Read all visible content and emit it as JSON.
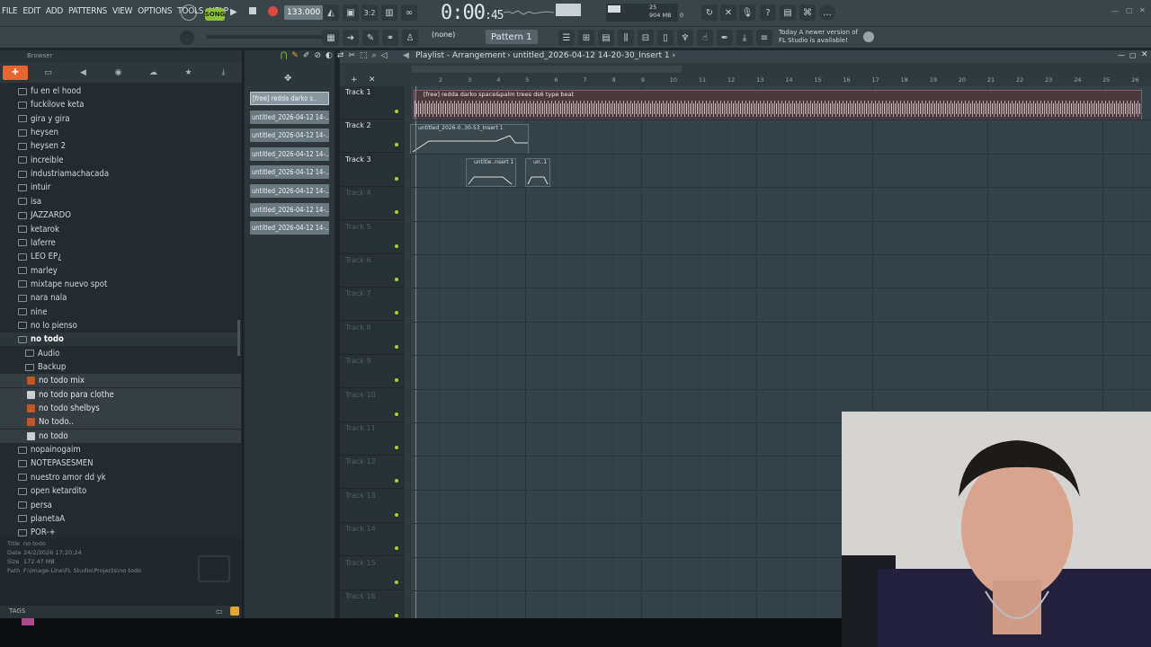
{
  "menu": [
    "FILE",
    "EDIT",
    "ADD",
    "PATTERNS",
    "VIEW",
    "OPTIONS",
    "TOOLS",
    "HELP"
  ],
  "transport": {
    "mode": "SONG",
    "tempo": "133.000",
    "time": "0:00",
    "time_sub": "45",
    "cpu": "25",
    "mem": "904 MB",
    "poly": "0"
  },
  "toolbar2": {
    "snap": "(none)",
    "pattern": "Pattern 1",
    "notice_line1": "Today  A newer version of",
    "notice_line2": "FL Studio is available!"
  },
  "browser": {
    "title": "Browser",
    "items": [
      {
        "label": "fu en el hood",
        "type": "folder"
      },
      {
        "label": "fuckilove keta",
        "type": "folder"
      },
      {
        "label": "gira y gira",
        "type": "folder"
      },
      {
        "label": "heysen",
        "type": "folder"
      },
      {
        "label": "heysen 2",
        "type": "folder"
      },
      {
        "label": "increible",
        "type": "folder"
      },
      {
        "label": "industriamachacada",
        "type": "folder"
      },
      {
        "label": "intuir",
        "type": "folder"
      },
      {
        "label": "isa",
        "type": "folder"
      },
      {
        "label": "JAZZARDO",
        "type": "folder"
      },
      {
        "label": "ketarok",
        "type": "folder"
      },
      {
        "label": "laferre",
        "type": "folder"
      },
      {
        "label": "LEO EP¿",
        "type": "folder"
      },
      {
        "label": "marley",
        "type": "folder"
      },
      {
        "label": "mixtape nuevo spot",
        "type": "folder"
      },
      {
        "label": "nara nala",
        "type": "folder"
      },
      {
        "label": "nine",
        "type": "folder"
      },
      {
        "label": "no lo pienso",
        "type": "folder"
      },
      {
        "label": "no todo",
        "type": "open"
      },
      {
        "label": "Audio",
        "type": "sub"
      },
      {
        "label": "Backup",
        "type": "sub"
      },
      {
        "label": "no todo mix",
        "type": "file"
      },
      {
        "label": "no todo para clothe",
        "type": "plainfile"
      },
      {
        "label": "no todo shelbys",
        "type": "file"
      },
      {
        "label": "No todo..",
        "type": "file"
      },
      {
        "label": "no todo",
        "type": "plainfile"
      },
      {
        "label": "nopainogaim",
        "type": "folder"
      },
      {
        "label": "NOTEPASESMEN",
        "type": "folder"
      },
      {
        "label": "nuestro amor dd yk",
        "type": "folder"
      },
      {
        "label": "open ketardito",
        "type": "folder"
      },
      {
        "label": "persa",
        "type": "folder"
      },
      {
        "label": "planetaA",
        "type": "folder"
      },
      {
        "label": "POR-+",
        "type": "folder"
      }
    ],
    "info": {
      "title_k": "Title",
      "title_v": "no todo",
      "date_k": "Date",
      "date_v": "24/2/2026 17:20:24",
      "size_k": "Size",
      "size_v": "172.47 MB",
      "path_k": "Path",
      "path_v": "F:\\Image-Line\\FL Studio\\Projects\\no todo"
    },
    "tags": "TAGS"
  },
  "channels": [
    "[free] redda darko s..",
    "untitled_2026-04-12 14-..",
    "untitled_2026-04-12 14-..",
    "untitled_2026-04-12 14-..",
    "untitled_2026-04-12 14-..",
    "untitled_2026-04-12 14-..",
    "untitled_2026-04-12 14-..",
    "untitled_2026-04-12 14-.."
  ],
  "playlist": {
    "title": "Playlist - Arrangement",
    "title_suffix": "untitled_2026-04-12 14-20-30_Insert 1",
    "ruler": [
      "2",
      "3",
      "4",
      "5",
      "6",
      "7",
      "8",
      "9",
      "10",
      "11",
      "12",
      "13",
      "14",
      "15",
      "16",
      "17",
      "18",
      "19",
      "20",
      "21",
      "22",
      "23",
      "24",
      "25",
      "26"
    ],
    "tracks": [
      "Track 1",
      "Track 2",
      "Track 3",
      "Track 4",
      "Track 5",
      "Track 6",
      "Track 7",
      "Track 8",
      "Track 9",
      "Track 10",
      "Track 11",
      "Track 12",
      "Track 13",
      "Track 14",
      "Track 15",
      "Track 16"
    ],
    "audio_clip": "[free] redda  darko  space&palm trees  ds6 type beat",
    "auto_clip_1": "untitled_2026-0..30-53_Insert 1",
    "auto_clip_2": "untitle..nsert 1",
    "auto_clip_3": "un..1"
  }
}
